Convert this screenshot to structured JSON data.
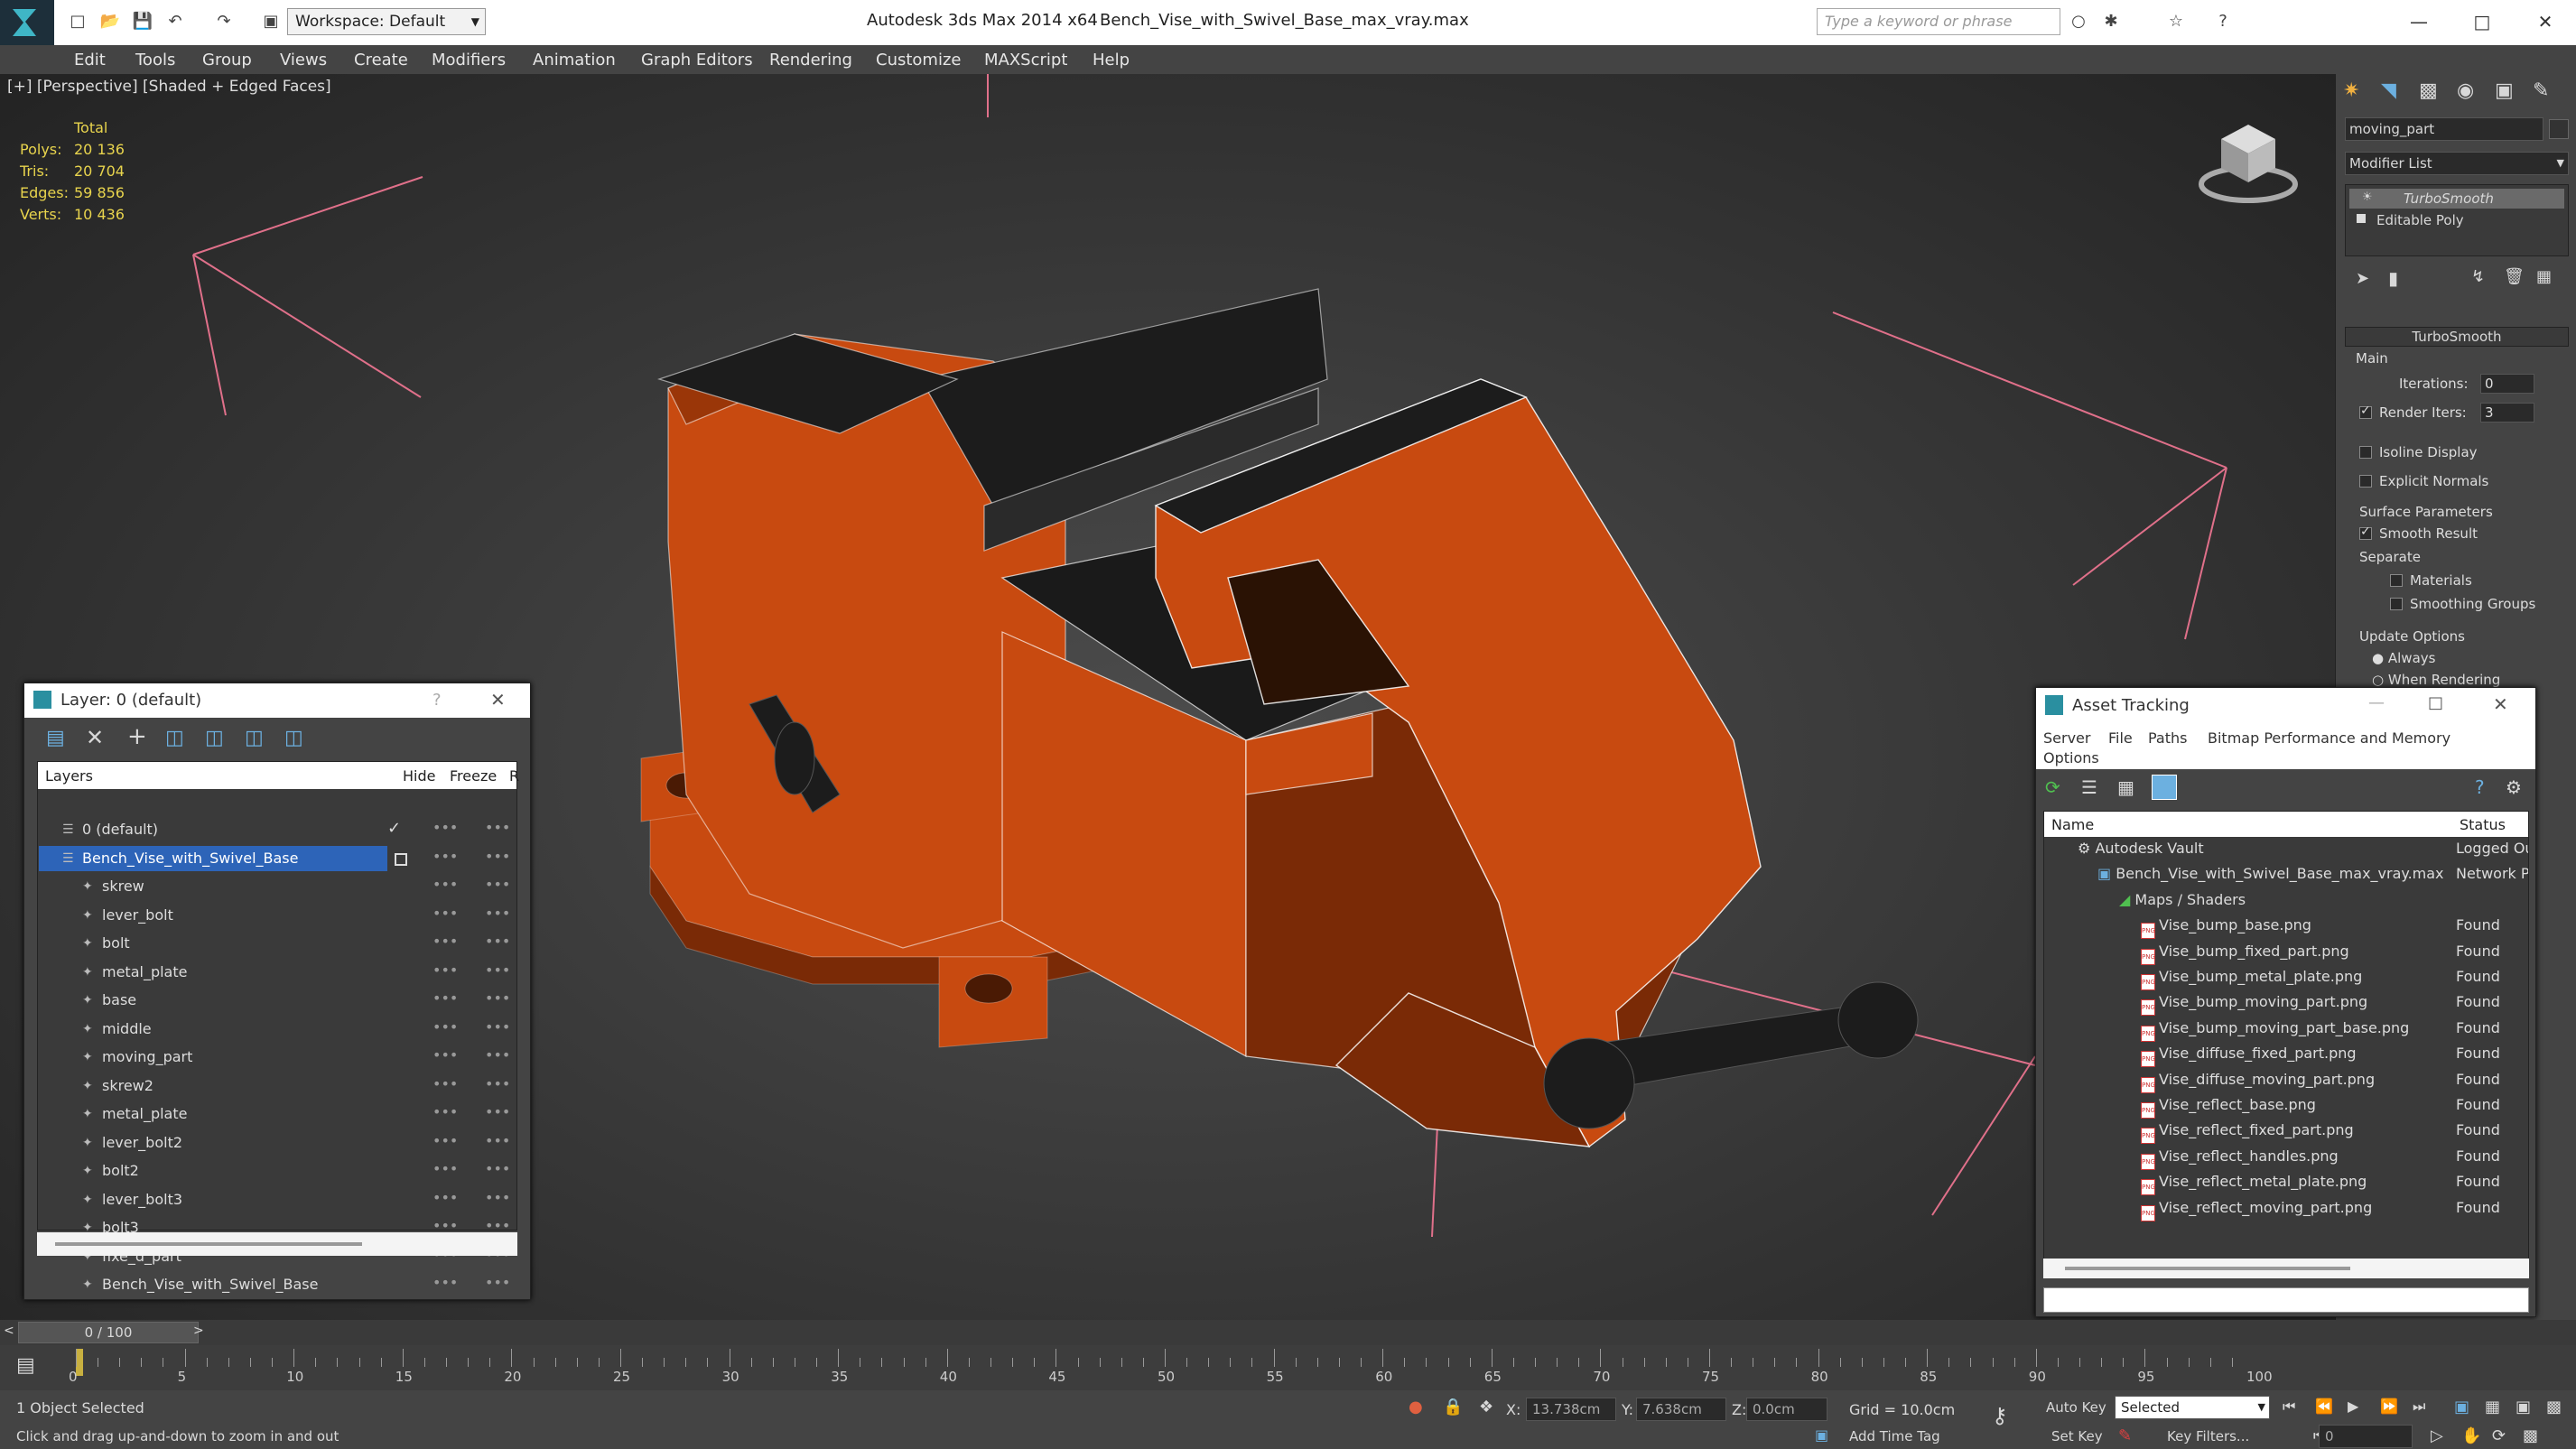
{
  "app": {
    "title": "Autodesk 3ds Max  2014 x64",
    "file": "Bench_Vise_with_Swivel_Base_max_vray.max",
    "workspace": "Workspace: Default",
    "search_placeholder": "Type a keyword or phrase"
  },
  "menu": [
    "Edit",
    "Tools",
    "Group",
    "Views",
    "Create",
    "Modifiers",
    "Animation",
    "Graph Editors",
    "Rendering",
    "Customize",
    "MAXScript",
    "Help"
  ],
  "viewport": {
    "label": "[+] [Perspective] [Shaded + Edged Faces]",
    "stats": {
      "header": "Total",
      "rows": [
        {
          "k": "Polys:",
          "v": "20 136"
        },
        {
          "k": "Tris:",
          "v": "20 704"
        },
        {
          "k": "Edges:",
          "v": "59 856"
        },
        {
          "k": "Verts:",
          "v": "10 436"
        }
      ]
    },
    "colors": {
      "orange": "#c84a10",
      "dark_orange": "#7a2a06",
      "black": "#1c1c1c",
      "wire": "#ffffff",
      "light_line": "#e0708a"
    }
  },
  "command_panel": {
    "object_name": "moving_part",
    "modifier_list": "Modifier List",
    "stack": [
      "TurboSmooth",
      "Editable Poly"
    ],
    "rollout_title": "TurboSmooth",
    "main_label": "Main",
    "iterations_label": "Iterations:",
    "iterations_value": "0",
    "render_iters_label": "Render Iters:",
    "render_iters_value": "3",
    "isoline": "Isoline Display",
    "explicit": "Explicit Normals",
    "surface_params": "Surface Parameters",
    "smooth_result": "Smooth Result",
    "separate": "Separate",
    "materials": "Materials",
    "smoothing_groups": "Smoothing Groups",
    "update_options": "Update Options",
    "always": "Always",
    "when_rendering": "When Rendering"
  },
  "layer_window": {
    "title": "Layer: 0 (default)",
    "help": "?",
    "col_layers": "Layers",
    "col_hide": "Hide",
    "col_freeze": "Freeze",
    "col_r": "R",
    "rows": [
      {
        "name": "0 (default)",
        "level": 0
      },
      {
        "name": "Bench_Vise_with_Swivel_Base",
        "level": 0,
        "selected": true
      },
      {
        "name": "skrew",
        "level": 1
      },
      {
        "name": "lever_bolt",
        "level": 1
      },
      {
        "name": "bolt",
        "level": 1
      },
      {
        "name": "metal_plate",
        "level": 1
      },
      {
        "name": "base",
        "level": 1
      },
      {
        "name": "middle",
        "level": 1
      },
      {
        "name": "moving_part",
        "level": 1
      },
      {
        "name": "skrew2",
        "level": 1
      },
      {
        "name": "metal_plate",
        "level": 1
      },
      {
        "name": "lever_bolt2",
        "level": 1
      },
      {
        "name": "bolt2",
        "level": 1
      },
      {
        "name": "lever_bolt3",
        "level": 1
      },
      {
        "name": "bolt3",
        "level": 1
      },
      {
        "name": "fixe_d_part",
        "level": 1
      },
      {
        "name": "Bench_Vise_with_Swivel_Base",
        "level": 1
      }
    ]
  },
  "asset_window": {
    "title": "Asset Tracking",
    "menu": [
      "Server",
      "File",
      "Paths",
      "Bitmap Performance and Memory",
      "Options"
    ],
    "col_name": "Name",
    "col_status": "Status",
    "rows": [
      {
        "name": "Autodesk Vault",
        "status": "Logged Ou",
        "indent": 1
      },
      {
        "name": "Bench_Vise_with_Swivel_Base_max_vray.max",
        "status": "Network Pa",
        "indent": 2
      },
      {
        "name": "Maps / Shaders",
        "status": "",
        "indent": 3
      },
      {
        "name": "Vise_bump_base.png",
        "status": "Found",
        "indent": 4
      },
      {
        "name": "Vise_bump_fixed_part.png",
        "status": "Found",
        "indent": 4
      },
      {
        "name": "Vise_bump_metal_plate.png",
        "status": "Found",
        "indent": 4
      },
      {
        "name": "Vise_bump_moving_part.png",
        "status": "Found",
        "indent": 4
      },
      {
        "name": "Vise_bump_moving_part_base.png",
        "status": "Found",
        "indent": 4
      },
      {
        "name": "Vise_diffuse_fixed_part.png",
        "status": "Found",
        "indent": 4
      },
      {
        "name": "Vise_diffuse_moving_part.png",
        "status": "Found",
        "indent": 4
      },
      {
        "name": "Vise_reflect_base.png",
        "status": "Found",
        "indent": 4
      },
      {
        "name": "Vise_reflect_fixed_part.png",
        "status": "Found",
        "indent": 4
      },
      {
        "name": "Vise_reflect_handles.png",
        "status": "Found",
        "indent": 4
      },
      {
        "name": "Vise_reflect_metal_plate.png",
        "status": "Found",
        "indent": 4
      },
      {
        "name": "Vise_reflect_moving_part.png",
        "status": "Found",
        "indent": 4
      }
    ]
  },
  "timeline": {
    "frame": "0 / 100",
    "ticks": [
      "0",
      "5",
      "10",
      "15",
      "20",
      "25",
      "30",
      "35",
      "40",
      "45",
      "50",
      "55",
      "60",
      "65",
      "70",
      "75",
      "80",
      "85",
      "90",
      "95",
      "100"
    ]
  },
  "status": {
    "selection": "1 Object Selected",
    "prompt": "Click and drag up-and-down to zoom in and out",
    "x_label": "X:",
    "x": "13.738cm",
    "y_label": "Y:",
    "y": "7.638cm",
    "z_label": "Z:",
    "z": "0.0cm",
    "grid": "Grid = 10.0cm",
    "add_time_tag": "Add Time Tag",
    "auto_key": "Auto Key",
    "set_key": "Set Key",
    "selected": "Selected",
    "key_filters": "Key Filters...",
    "frame_field": "0"
  }
}
